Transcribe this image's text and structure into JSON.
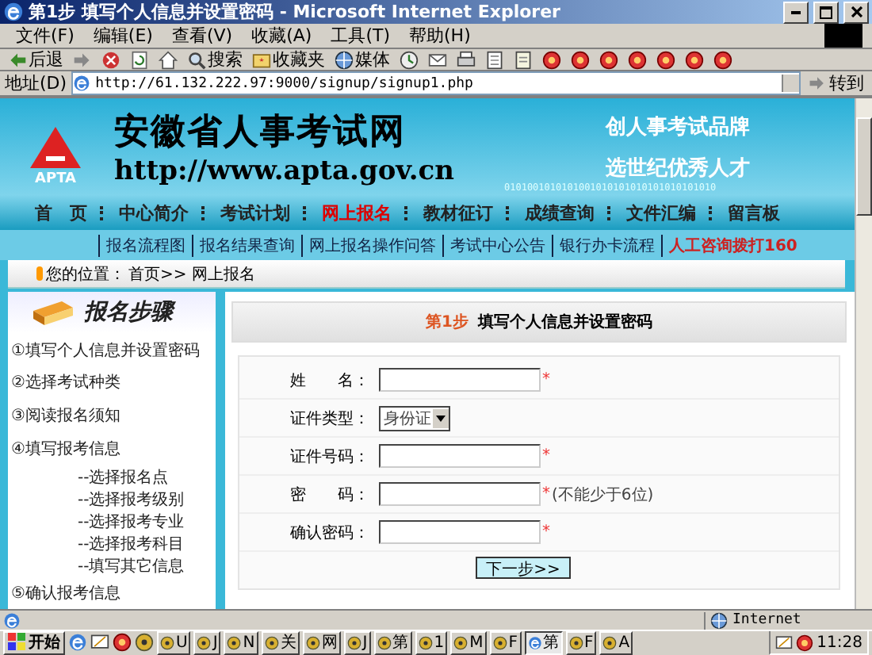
{
  "window": {
    "title": "第1步  填写个人信息并设置密码 - Microsoft Internet Explorer"
  },
  "menu": [
    "文件(F)",
    "编辑(E)",
    "查看(V)",
    "收藏(A)",
    "工具(T)",
    "帮助(H)"
  ],
  "toolbar": [
    {
      "kind": "back",
      "label": "后退"
    },
    {
      "kind": "forward"
    },
    {
      "kind": "stop"
    },
    {
      "kind": "refresh"
    },
    {
      "kind": "home"
    },
    {
      "kind": "search",
      "label": "搜索"
    },
    {
      "kind": "favorites",
      "label": "收藏夹"
    },
    {
      "kind": "media",
      "label": "媒体"
    },
    {
      "kind": "history"
    },
    {
      "kind": "mail"
    },
    {
      "kind": "print"
    },
    {
      "kind": "edit"
    },
    {
      "kind": "note"
    },
    {
      "kind": "plugin"
    },
    {
      "kind": "plugin"
    },
    {
      "kind": "plugin"
    },
    {
      "kind": "plugin"
    },
    {
      "kind": "plugin"
    },
    {
      "kind": "plugin"
    },
    {
      "kind": "plugin"
    }
  ],
  "address": {
    "label": "地址(D)",
    "value": "http://61.132.222.97:9000/signup/signup1.php",
    "go": "转到"
  },
  "site": {
    "logo": "APTA",
    "name": "安徽省人事考试网",
    "url": "http://www.apta.gov.cn",
    "slogans": [
      "创人事考试品牌",
      "选世纪优秀人才"
    ],
    "binary": "0101001010101001010101010101010101010"
  },
  "nav": [
    {
      "label": "首　页",
      "selected": false
    },
    {
      "label": "中心简介",
      "selected": false
    },
    {
      "label": "考试计划",
      "selected": false
    },
    {
      "label": "网上报名",
      "selected": true
    },
    {
      "label": "教材征订",
      "selected": false
    },
    {
      "label": "成绩查询",
      "selected": false
    },
    {
      "label": "文件汇编",
      "selected": false
    },
    {
      "label": "留言板",
      "selected": false
    }
  ],
  "subnav": [
    {
      "kind": "link",
      "label": "报名流程图"
    },
    {
      "kind": "link",
      "label": "报名结果查询"
    },
    {
      "kind": "link",
      "label": "网上报名操作问答"
    },
    {
      "kind": "link",
      "label": "考试中心公告"
    },
    {
      "kind": "link",
      "label": "银行办卡流程"
    },
    {
      "kind": "hotline",
      "label": "人工咨询拨打160"
    }
  ],
  "breadcrumb": {
    "label": "您的位置：",
    "path": "首页>> 网上报名"
  },
  "steps": {
    "title": "报名步骤",
    "items": [
      {
        "label": "①填写个人信息并设置密码"
      },
      {
        "label": "②选择考试种类"
      },
      {
        "label": "③阅读报名须知"
      },
      {
        "label": "④填写报考信息",
        "children": [
          {
            "label": "--选择报名点"
          },
          {
            "label": "--选择报考级别"
          },
          {
            "label": "--选择报考专业"
          },
          {
            "label": "--选择报考科目"
          },
          {
            "label": "--填写其它信息"
          }
        ]
      },
      {
        "label": "⑤确认报考信息"
      }
    ]
  },
  "form": {
    "step": "第1步",
    "title": "填写个人信息并设置密码",
    "fields": [
      {
        "kind": "text",
        "label": "姓　　名：",
        "mark": "*"
      },
      {
        "kind": "select",
        "label": "证件类型：",
        "value": "身份证"
      },
      {
        "kind": "text",
        "label": "证件号码：",
        "mark": "*"
      },
      {
        "kind": "password",
        "label": "密　　码：",
        "mark": "*",
        "note": "(不能少于6位)"
      },
      {
        "kind": "password",
        "label": "确认密码：",
        "mark": "*"
      }
    ],
    "submit": "下一步>>"
  },
  "status_bar": {
    "zone": "Internet"
  },
  "taskbar": {
    "start": "开始",
    "quick_launch": [
      {
        "kind": "ie"
      },
      {
        "kind": "desktop"
      },
      {
        "kind": "plugin"
      },
      {
        "kind": "app"
      }
    ],
    "tasks": [
      {
        "label": "U",
        "selected": false
      },
      {
        "label": "J",
        "selected": false
      },
      {
        "label": "N",
        "selected": false
      },
      {
        "label": "关",
        "selected": false
      },
      {
        "label": "网",
        "selected": false
      },
      {
        "label": "J",
        "selected": false
      },
      {
        "label": "第",
        "selected": false
      },
      {
        "label": "1",
        "selected": false
      },
      {
        "label": "M",
        "selected": false
      },
      {
        "label": "F",
        "selected": false
      },
      {
        "label": "第",
        "selected": true
      },
      {
        "label": "F",
        "selected": false
      },
      {
        "label": "A",
        "selected": false
      }
    ],
    "clock": "11:28"
  }
}
